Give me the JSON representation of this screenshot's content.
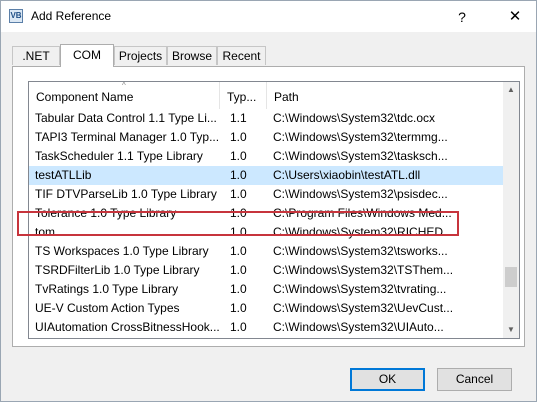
{
  "window": {
    "title": "Add Reference",
    "icon_text": "VB",
    "help_glyph": "?",
    "close_glyph": "✕"
  },
  "tabs": [
    {
      "label": ".NET",
      "active": false
    },
    {
      "label": "COM",
      "active": true
    },
    {
      "label": "Projects",
      "active": false
    },
    {
      "label": "Browse",
      "active": false
    },
    {
      "label": "Recent",
      "active": false
    }
  ],
  "list": {
    "columns": [
      "Component Name",
      "Typ...",
      "Path"
    ],
    "sort_indicator": "^",
    "rows": [
      {
        "name": "Tabular Data Control 1.1 Type Li...",
        "type": "1.1",
        "path": "C:\\Windows\\System32\\tdc.ocx",
        "selected": false
      },
      {
        "name": "TAPI3 Terminal Manager 1.0 Typ...",
        "type": "1.0",
        "path": "C:\\Windows\\System32\\termmg...",
        "selected": false
      },
      {
        "name": "TaskScheduler 1.1 Type Library",
        "type": "1.0",
        "path": "C:\\Windows\\System32\\tasksch...",
        "selected": false
      },
      {
        "name": "testATLLib",
        "type": "1.0",
        "path": "C:\\Users\\xiaobin\\testATL.dll",
        "selected": true
      },
      {
        "name": "TIF DTVParseLib 1.0 Type Library",
        "type": "1.0",
        "path": "C:\\Windows\\System32\\psisdec...",
        "selected": false
      },
      {
        "name": "Tolerance 1.0 Type Library",
        "type": "1.0",
        "path": "C:\\Program Files\\Windows Med...",
        "selected": false
      },
      {
        "name": "tom",
        "type": "1.0",
        "path": "C:\\Windows\\System32\\RICHED...",
        "selected": false
      },
      {
        "name": "TS Workspaces 1.0 Type Library",
        "type": "1.0",
        "path": "C:\\Windows\\System32\\tsworks...",
        "selected": false
      },
      {
        "name": "TSRDFilterLib 1.0 Type Library",
        "type": "1.0",
        "path": "C:\\Windows\\System32\\TSThem...",
        "selected": false
      },
      {
        "name": "TvRatings 1.0 Type Library",
        "type": "1.0",
        "path": "C:\\Windows\\System32\\tvrating...",
        "selected": false
      },
      {
        "name": "UE-V Custom Action Types",
        "type": "1.0",
        "path": "C:\\Windows\\System32\\UevCust...",
        "selected": false
      },
      {
        "name": "UIAutomation CrossBitnessHook...",
        "type": "1.0",
        "path": "C:\\Windows\\System32\\UIAuto...",
        "selected": false
      }
    ]
  },
  "buttons": {
    "ok": "OK",
    "cancel": "Cancel"
  },
  "colors": {
    "selection": "#cce8ff",
    "highlight_box": "#c7343c",
    "default_button_border": "#0078d7"
  }
}
